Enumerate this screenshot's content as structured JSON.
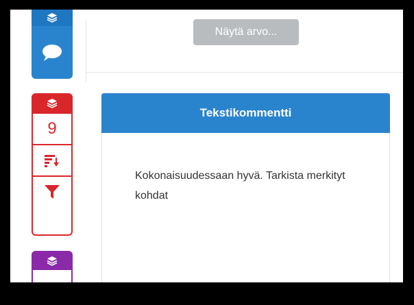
{
  "main": {
    "show_value_button": "Näytä arvo...",
    "panel": {
      "title": "Tekstikommentti",
      "comment": "Kokonaisuudessaan hyvä. Tarkista merkityt kohdat"
    }
  },
  "rail": {
    "blue_group": {
      "color": "#2a84cd",
      "icons": [
        "layers-icon",
        "comment-icon"
      ]
    },
    "red_group": {
      "color": "#d9262b",
      "count": "9",
      "icons": [
        "layers-icon",
        "sort-icon",
        "filter-icon"
      ]
    },
    "purple_group": {
      "color": "#8a2aa8",
      "icons": [
        "layers-icon"
      ]
    }
  }
}
